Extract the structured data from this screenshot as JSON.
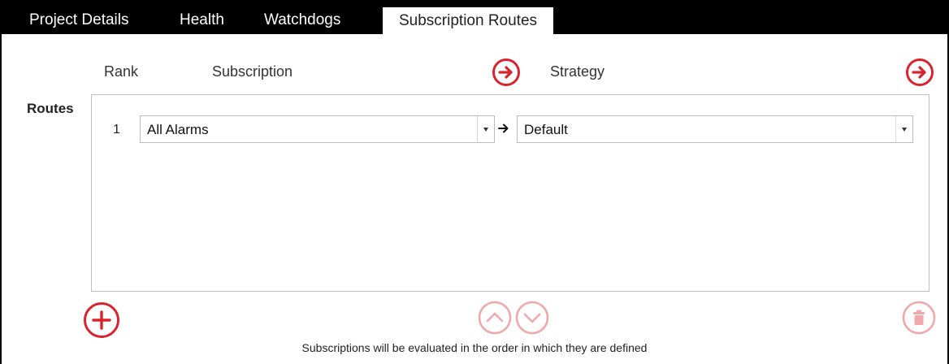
{
  "tabs": [
    {
      "label": "Project Details",
      "active": false
    },
    {
      "label": "Health",
      "active": false
    },
    {
      "label": "Watchdogs",
      "active": false
    },
    {
      "label": "Subscription Routes",
      "active": true
    }
  ],
  "headers": {
    "rank": "Rank",
    "subscription": "Subscription",
    "strategy": "Strategy"
  },
  "routes_label": "Routes",
  "routes": [
    {
      "rank": "1",
      "subscription": "All Alarms",
      "strategy": "Default"
    }
  ],
  "footer_note": "Subscriptions will be evaluated in the order in which they are defined",
  "icons": {
    "subscription_go": "arrow-right-circle-icon",
    "strategy_go": "arrow-right-circle-icon",
    "add": "plus-circle-icon",
    "move_up": "chevron-up-circle-icon",
    "move_down": "chevron-down-circle-icon",
    "delete": "trash-circle-icon",
    "route_link": "arrow-right-icon"
  },
  "colors": {
    "accent": "#d9232d",
    "accent_disabled": "#f0a8aa",
    "tabbar": "#000000"
  }
}
